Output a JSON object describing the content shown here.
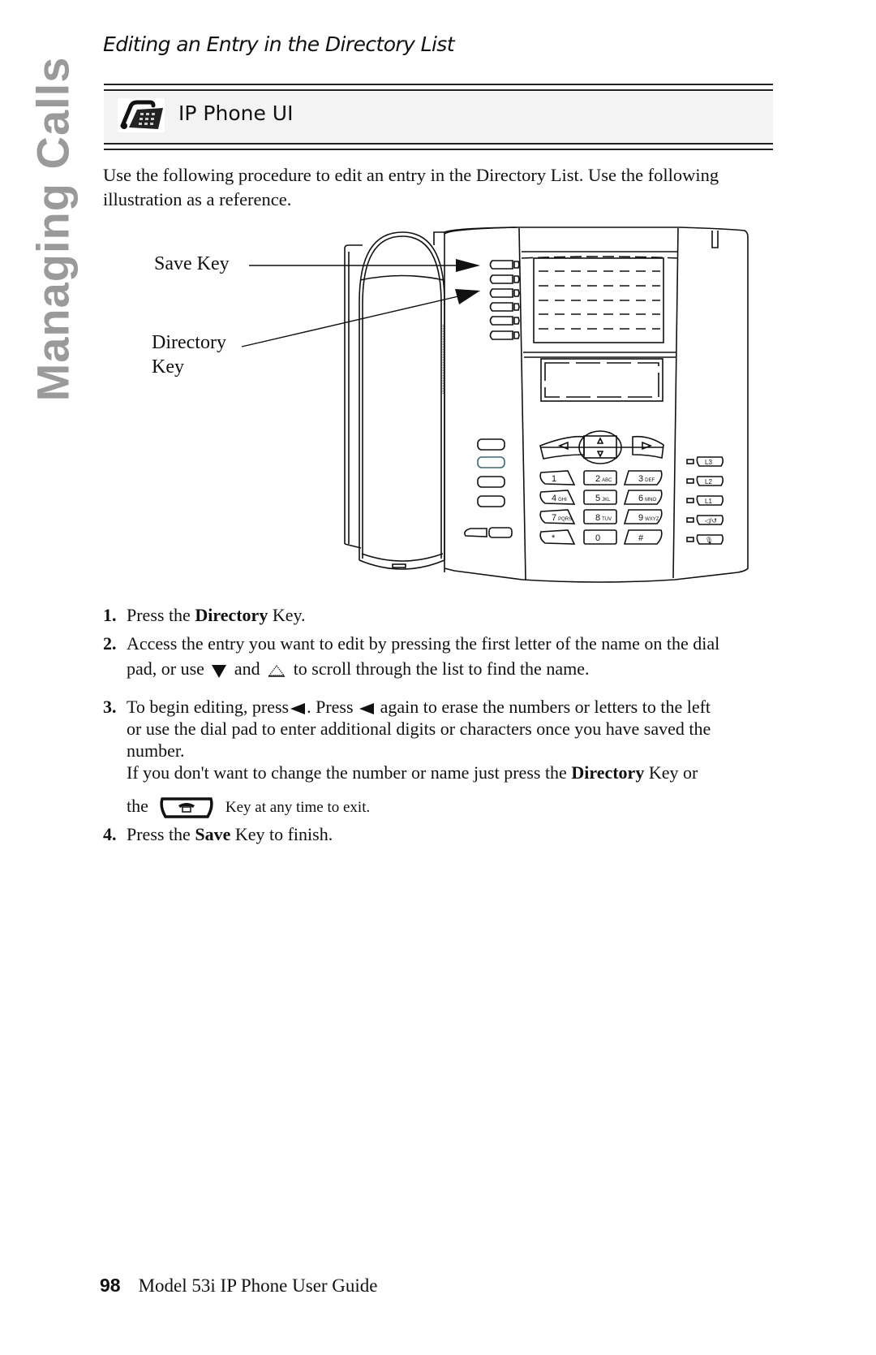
{
  "sidebar": {
    "chapter_label": "Managing Calls"
  },
  "section": {
    "title": "Editing an Entry in the Directory List"
  },
  "banner": {
    "icon": "desk-phone-icon",
    "label": "IP Phone UI"
  },
  "intro": "Use the following procedure to edit an entry in the Directory List. Use the following illustration as a reference.",
  "illustration": {
    "callouts": {
      "save_key": "Save Key",
      "directory_key_line1": "Directory",
      "directory_key_line2": "Key"
    },
    "keypad": [
      {
        "digit": "1",
        "letters": ""
      },
      {
        "digit": "2",
        "letters": "ABC"
      },
      {
        "digit": "3",
        "letters": "DEF"
      },
      {
        "digit": "4",
        "letters": "GHI"
      },
      {
        "digit": "5",
        "letters": "JKL"
      },
      {
        "digit": "6",
        "letters": "MNO"
      },
      {
        "digit": "7",
        "letters": "PQRS"
      },
      {
        "digit": "8",
        "letters": "TUV"
      },
      {
        "digit": "9",
        "letters": "WXYZ"
      },
      {
        "digit": "*",
        "letters": ""
      },
      {
        "digit": "0",
        "letters": ""
      },
      {
        "digit": "#",
        "letters": ""
      }
    ],
    "line_keys": [
      "L3",
      "L2",
      "L1",
      "◁/↺",
      "🎙"
    ],
    "left_keys": [
      "goodbye-icon",
      "options-icon",
      "headset-icon",
      "hold-icon"
    ],
    "volume_keys": [
      "volume-down-icon",
      "volume-up-icon"
    ]
  },
  "steps": [
    {
      "num": "1.",
      "parts": [
        {
          "t": "Press the "
        },
        {
          "t": "Directory",
          "b": true
        },
        {
          "t": " Key."
        }
      ]
    },
    {
      "num": "2.",
      "line1": "Access the entry you want to edit by pressing the first letter of the name on the dial",
      "line2_a": "pad, or use",
      "line2_b": "and",
      "line2_c": "to scroll through the list to find the name.",
      "icons": [
        "down-arrow-icon",
        "up-arrow-icon"
      ]
    },
    {
      "num": "3.",
      "line1_a": "To begin editing, press",
      "line1_b": ". Press",
      "line1_c": "again to erase the numbers or letters to the left",
      "line2": "or use the dial pad to enter additional digits or characters once you have saved the",
      "line3": "number.",
      "line4_a": "If you don't want to change the number or name just press the",
      "line4_b": "Directory",
      "line4_c": "Key or",
      "line5_a": "the",
      "line5_b": "Key at any time to exit.",
      "icons": [
        "left-arrow-icon",
        "left-arrow-icon",
        "goodbye-key-icon"
      ]
    },
    {
      "num": "4.",
      "parts": [
        {
          "t": "Press the "
        },
        {
          "t": "Save",
          "b": true
        },
        {
          "t": " Key to finish."
        }
      ]
    }
  ],
  "footer": {
    "page_number": "98",
    "title": "Model 53i IP Phone User Guide"
  }
}
